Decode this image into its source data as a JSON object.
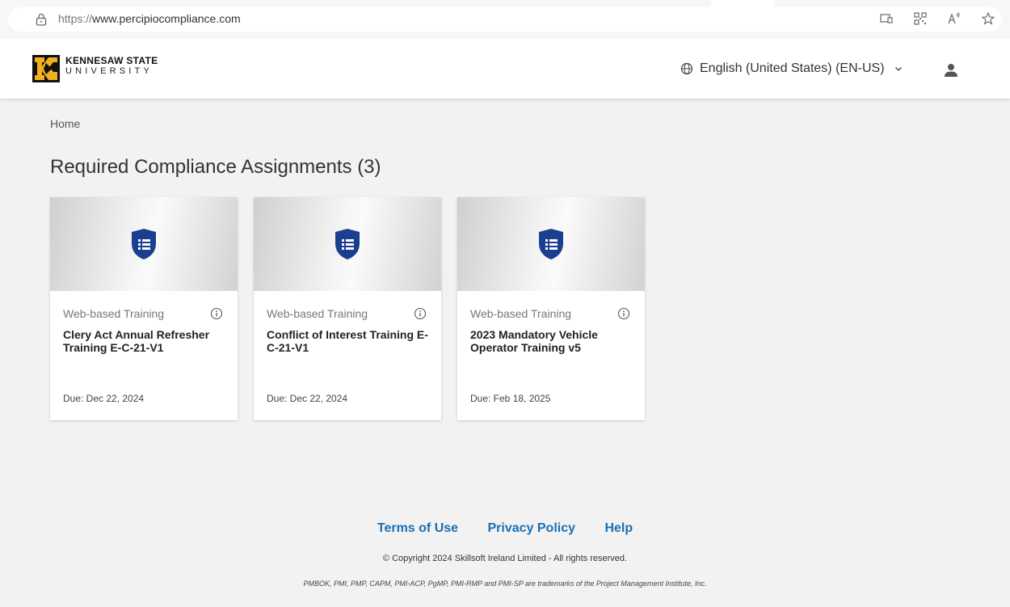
{
  "browser": {
    "url_protocol": "https://",
    "url_host": "www.percipiocompliance.com",
    "icons": [
      "reader-view-icon",
      "qr-code-icon",
      "read-aloud-icon",
      "favorite-star-icon"
    ]
  },
  "header": {
    "logo_line1": "KENNESAW STATE",
    "logo_line2": "UNIVERSITY",
    "language": "English (United States) (EN-US)"
  },
  "breadcrumb": "Home",
  "page_title": "Required Compliance Assignments (3)",
  "cards": [
    {
      "type": "Web-based Training",
      "title": "Clery Act Annual Refresher Training E-C-21-V1",
      "due": "Due: Dec 22, 2024"
    },
    {
      "type": "Web-based Training",
      "title": "Conflict of Interest Training E-C-21-V1",
      "due": "Due: Dec 22, 2024"
    },
    {
      "type": "Web-based Training",
      "title": "2023 Mandatory Vehicle Operator Training v5",
      "due": "Due: Feb 18, 2025"
    }
  ],
  "footer": {
    "links": [
      "Terms of Use",
      "Privacy Policy",
      "Help"
    ],
    "copyright": "© Copyright 2024 Skillsoft Ireland Limited - All rights reserved.",
    "trademarks": "PMBOK, PMI, PMP, CAPM, PMI-ACP, PgMP, PMI-RMP and PMI-SP are trademarks of the Project Management Institute, Inc."
  },
  "colors": {
    "accent_link": "#1a6fb3",
    "shield_blue": "#1b3f8f",
    "logo_gold": "#f2b01e"
  }
}
